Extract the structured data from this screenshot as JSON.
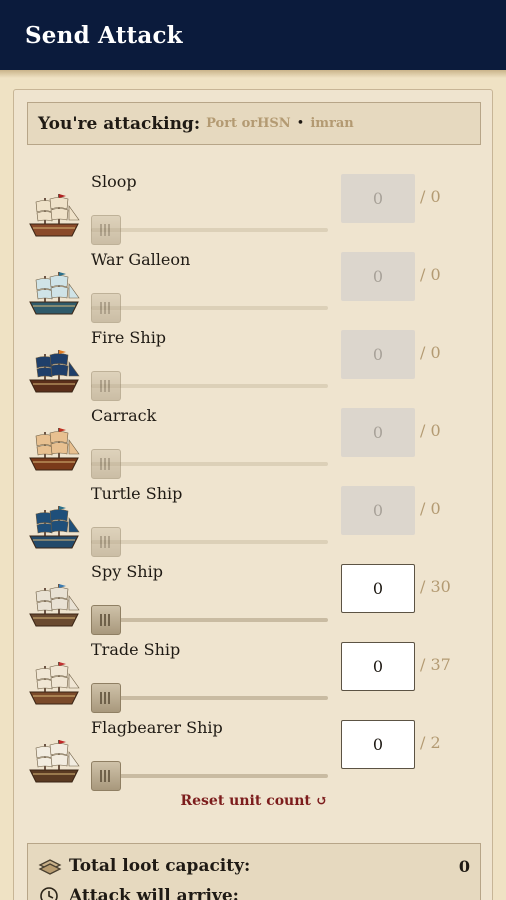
{
  "header": {
    "title": "Send Attack"
  },
  "target": {
    "label": "You're attacking:",
    "port": "Port orHSN",
    "separator": "•",
    "user": "imran"
  },
  "units": [
    {
      "name": "Sloop",
      "count": "0",
      "max": "/ 0",
      "enabled": false,
      "icon": "sloop-icon"
    },
    {
      "name": "War Galleon",
      "count": "0",
      "max": "/ 0",
      "enabled": false,
      "icon": "war-galleon-icon"
    },
    {
      "name": "Fire Ship",
      "count": "0",
      "max": "/ 0",
      "enabled": false,
      "icon": "fire-ship-icon"
    },
    {
      "name": "Carrack",
      "count": "0",
      "max": "/ 0",
      "enabled": false,
      "icon": "carrack-icon"
    },
    {
      "name": "Turtle Ship",
      "count": "0",
      "max": "/ 0",
      "enabled": false,
      "icon": "turtle-ship-icon"
    },
    {
      "name": "Spy Ship",
      "count": "0",
      "max": "/ 30",
      "enabled": true,
      "icon": "spy-ship-icon"
    },
    {
      "name": "Trade Ship",
      "count": "0",
      "max": "/ 37",
      "enabled": true,
      "icon": "trade-ship-icon"
    },
    {
      "name": "Flagbearer Ship",
      "count": "0",
      "max": "/ 2",
      "enabled": true,
      "icon": "flagbearer-ship-icon"
    }
  ],
  "reset": {
    "label": "Reset unit count",
    "icon": "↺"
  },
  "summary": {
    "loot_label": "Total loot capacity:",
    "loot_value": "0",
    "arrive_label": "Attack will arrive:"
  },
  "colors": {
    "header_bg": "#0b1b3c",
    "accent_text": "#b39a72",
    "reset_text": "#7c1c1c",
    "panel_bg": "#efe4cf"
  }
}
